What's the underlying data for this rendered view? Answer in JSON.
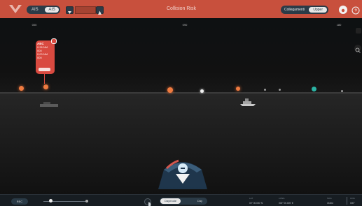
{
  "window_title": "Collision Risk",
  "top_bar": {
    "segmented": {
      "left": "AIS",
      "right": "AIS",
      "selected": "right"
    },
    "mode": {
      "left": "Collegamenti",
      "right": "Upper"
    },
    "icons": [
      "brand-logo",
      "filter-icon",
      "toggle-icon",
      "settings-icon",
      "help-icon"
    ]
  },
  "compass": {
    "labels": [
      "000",
      "090",
      "180"
    ]
  },
  "target_card": {
    "lines": [
      "ABC",
      "0.26 NM",
      "000",
      "0.00 NM",
      "000"
    ]
  },
  "scene": {
    "markers": [
      {
        "kind": "orange-buoy"
      },
      {
        "kind": "orange-buoy"
      },
      {
        "kind": "orange-buoy"
      },
      {
        "kind": "light"
      },
      {
        "kind": "orange-buoy"
      },
      {
        "kind": "light"
      },
      {
        "kind": "light"
      },
      {
        "kind": "teal-target"
      },
      {
        "kind": "light"
      }
    ]
  },
  "bottom_bar": {
    "record_label": "REC",
    "view_toggle": {
      "left": "Daymode",
      "right": "Day",
      "selected": "left"
    },
    "readouts": [
      {
        "label": "LAT",
        "value": "00° 00.000' N"
      },
      {
        "label": "LONG",
        "value": "000° 00.000' E"
      },
      {
        "label": "SOG",
        "value": "15.8kt"
      },
      {
        "label": "COG",
        "value": "000°"
      }
    ],
    "colors": {
      "accent": "#c8503d",
      "panel": "#171d22",
      "danger": "#d94a40"
    }
  }
}
